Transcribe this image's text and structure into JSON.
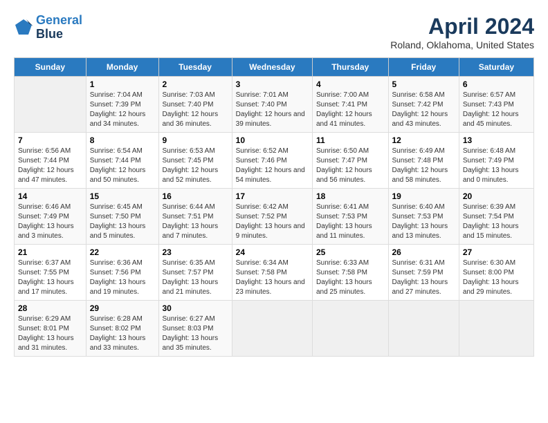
{
  "logo": {
    "line1": "General",
    "line2": "Blue"
  },
  "title": "April 2024",
  "subtitle": "Roland, Oklahoma, United States",
  "weekdays": [
    "Sunday",
    "Monday",
    "Tuesday",
    "Wednesday",
    "Thursday",
    "Friday",
    "Saturday"
  ],
  "weeks": [
    [
      {
        "day": "",
        "sunrise": "",
        "sunset": "",
        "daylight": ""
      },
      {
        "day": "1",
        "sunrise": "Sunrise: 7:04 AM",
        "sunset": "Sunset: 7:39 PM",
        "daylight": "Daylight: 12 hours and 34 minutes."
      },
      {
        "day": "2",
        "sunrise": "Sunrise: 7:03 AM",
        "sunset": "Sunset: 7:40 PM",
        "daylight": "Daylight: 12 hours and 36 minutes."
      },
      {
        "day": "3",
        "sunrise": "Sunrise: 7:01 AM",
        "sunset": "Sunset: 7:40 PM",
        "daylight": "Daylight: 12 hours and 39 minutes."
      },
      {
        "day": "4",
        "sunrise": "Sunrise: 7:00 AM",
        "sunset": "Sunset: 7:41 PM",
        "daylight": "Daylight: 12 hours and 41 minutes."
      },
      {
        "day": "5",
        "sunrise": "Sunrise: 6:58 AM",
        "sunset": "Sunset: 7:42 PM",
        "daylight": "Daylight: 12 hours and 43 minutes."
      },
      {
        "day": "6",
        "sunrise": "Sunrise: 6:57 AM",
        "sunset": "Sunset: 7:43 PM",
        "daylight": "Daylight: 12 hours and 45 minutes."
      }
    ],
    [
      {
        "day": "7",
        "sunrise": "Sunrise: 6:56 AM",
        "sunset": "Sunset: 7:44 PM",
        "daylight": "Daylight: 12 hours and 47 minutes."
      },
      {
        "day": "8",
        "sunrise": "Sunrise: 6:54 AM",
        "sunset": "Sunset: 7:44 PM",
        "daylight": "Daylight: 12 hours and 50 minutes."
      },
      {
        "day": "9",
        "sunrise": "Sunrise: 6:53 AM",
        "sunset": "Sunset: 7:45 PM",
        "daylight": "Daylight: 12 hours and 52 minutes."
      },
      {
        "day": "10",
        "sunrise": "Sunrise: 6:52 AM",
        "sunset": "Sunset: 7:46 PM",
        "daylight": "Daylight: 12 hours and 54 minutes."
      },
      {
        "day": "11",
        "sunrise": "Sunrise: 6:50 AM",
        "sunset": "Sunset: 7:47 PM",
        "daylight": "Daylight: 12 hours and 56 minutes."
      },
      {
        "day": "12",
        "sunrise": "Sunrise: 6:49 AM",
        "sunset": "Sunset: 7:48 PM",
        "daylight": "Daylight: 12 hours and 58 minutes."
      },
      {
        "day": "13",
        "sunrise": "Sunrise: 6:48 AM",
        "sunset": "Sunset: 7:49 PM",
        "daylight": "Daylight: 13 hours and 0 minutes."
      }
    ],
    [
      {
        "day": "14",
        "sunrise": "Sunrise: 6:46 AM",
        "sunset": "Sunset: 7:49 PM",
        "daylight": "Daylight: 13 hours and 3 minutes."
      },
      {
        "day": "15",
        "sunrise": "Sunrise: 6:45 AM",
        "sunset": "Sunset: 7:50 PM",
        "daylight": "Daylight: 13 hours and 5 minutes."
      },
      {
        "day": "16",
        "sunrise": "Sunrise: 6:44 AM",
        "sunset": "Sunset: 7:51 PM",
        "daylight": "Daylight: 13 hours and 7 minutes."
      },
      {
        "day": "17",
        "sunrise": "Sunrise: 6:42 AM",
        "sunset": "Sunset: 7:52 PM",
        "daylight": "Daylight: 13 hours and 9 minutes."
      },
      {
        "day": "18",
        "sunrise": "Sunrise: 6:41 AM",
        "sunset": "Sunset: 7:53 PM",
        "daylight": "Daylight: 13 hours and 11 minutes."
      },
      {
        "day": "19",
        "sunrise": "Sunrise: 6:40 AM",
        "sunset": "Sunset: 7:53 PM",
        "daylight": "Daylight: 13 hours and 13 minutes."
      },
      {
        "day": "20",
        "sunrise": "Sunrise: 6:39 AM",
        "sunset": "Sunset: 7:54 PM",
        "daylight": "Daylight: 13 hours and 15 minutes."
      }
    ],
    [
      {
        "day": "21",
        "sunrise": "Sunrise: 6:37 AM",
        "sunset": "Sunset: 7:55 PM",
        "daylight": "Daylight: 13 hours and 17 minutes."
      },
      {
        "day": "22",
        "sunrise": "Sunrise: 6:36 AM",
        "sunset": "Sunset: 7:56 PM",
        "daylight": "Daylight: 13 hours and 19 minutes."
      },
      {
        "day": "23",
        "sunrise": "Sunrise: 6:35 AM",
        "sunset": "Sunset: 7:57 PM",
        "daylight": "Daylight: 13 hours and 21 minutes."
      },
      {
        "day": "24",
        "sunrise": "Sunrise: 6:34 AM",
        "sunset": "Sunset: 7:58 PM",
        "daylight": "Daylight: 13 hours and 23 minutes."
      },
      {
        "day": "25",
        "sunrise": "Sunrise: 6:33 AM",
        "sunset": "Sunset: 7:58 PM",
        "daylight": "Daylight: 13 hours and 25 minutes."
      },
      {
        "day": "26",
        "sunrise": "Sunrise: 6:31 AM",
        "sunset": "Sunset: 7:59 PM",
        "daylight": "Daylight: 13 hours and 27 minutes."
      },
      {
        "day": "27",
        "sunrise": "Sunrise: 6:30 AM",
        "sunset": "Sunset: 8:00 PM",
        "daylight": "Daylight: 13 hours and 29 minutes."
      }
    ],
    [
      {
        "day": "28",
        "sunrise": "Sunrise: 6:29 AM",
        "sunset": "Sunset: 8:01 PM",
        "daylight": "Daylight: 13 hours and 31 minutes."
      },
      {
        "day": "29",
        "sunrise": "Sunrise: 6:28 AM",
        "sunset": "Sunset: 8:02 PM",
        "daylight": "Daylight: 13 hours and 33 minutes."
      },
      {
        "day": "30",
        "sunrise": "Sunrise: 6:27 AM",
        "sunset": "Sunset: 8:03 PM",
        "daylight": "Daylight: 13 hours and 35 minutes."
      },
      {
        "day": "",
        "sunrise": "",
        "sunset": "",
        "daylight": ""
      },
      {
        "day": "",
        "sunrise": "",
        "sunset": "",
        "daylight": ""
      },
      {
        "day": "",
        "sunrise": "",
        "sunset": "",
        "daylight": ""
      },
      {
        "day": "",
        "sunrise": "",
        "sunset": "",
        "daylight": ""
      }
    ]
  ]
}
